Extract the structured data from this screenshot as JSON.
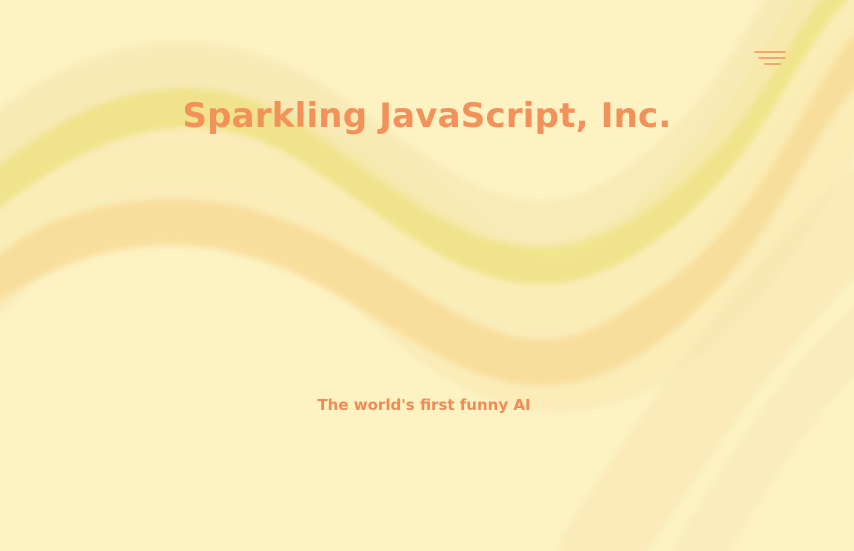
{
  "header": {
    "brand_name": "Sparkling JavaScript, Inc.",
    "menu_icon": "hamburger-menu-icon"
  },
  "hero": {
    "tagline": "The world's first funny AI"
  },
  "colors": {
    "background": "#fcf2c2",
    "accent": "#f3915b",
    "wave_yellow": "#efe58a",
    "wave_orange": "#f7d891"
  }
}
